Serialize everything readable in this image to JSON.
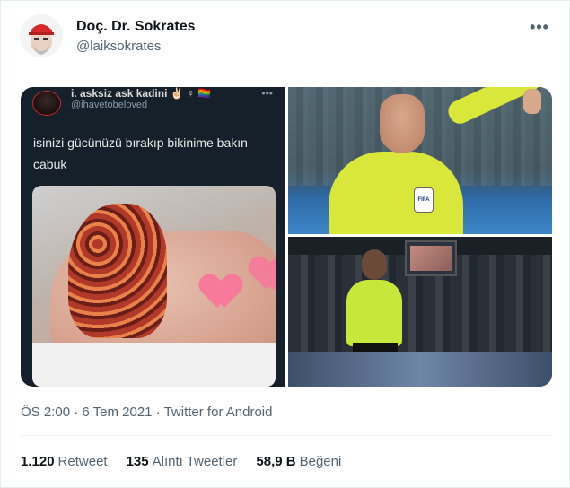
{
  "author": {
    "display_name": "Doç. Dr. Sokrates",
    "handle": "@laiksokrates",
    "avatar_icon": "avatar-icon"
  },
  "more_icon": "more-horizontal-icon",
  "media": {
    "embedded_tweet": {
      "display_name": "i. asksiz ask kadini ✌🏻 ♀ 🏳️‍🌈",
      "handle": "@ihavetobeloved",
      "more": "•••",
      "text": "isinizi gücünüzü bırakıp bikinime bakın cabuk"
    },
    "badge_text": "FIFA"
  },
  "meta": {
    "time": "ÖS 2:00",
    "date": "6 Tem 2021",
    "separator": "·",
    "source": "Twitter for Android"
  },
  "stats": {
    "retweets_count": "1.120",
    "retweets_label": "Retweet",
    "quotes_count": "135",
    "quotes_label": "Alıntı Tweetler",
    "likes_count": "58,9 B",
    "likes_label": "Beğeni"
  },
  "colors": {
    "text_primary": "#0f1419",
    "text_secondary": "#536471",
    "border": "#e6ecf0"
  }
}
